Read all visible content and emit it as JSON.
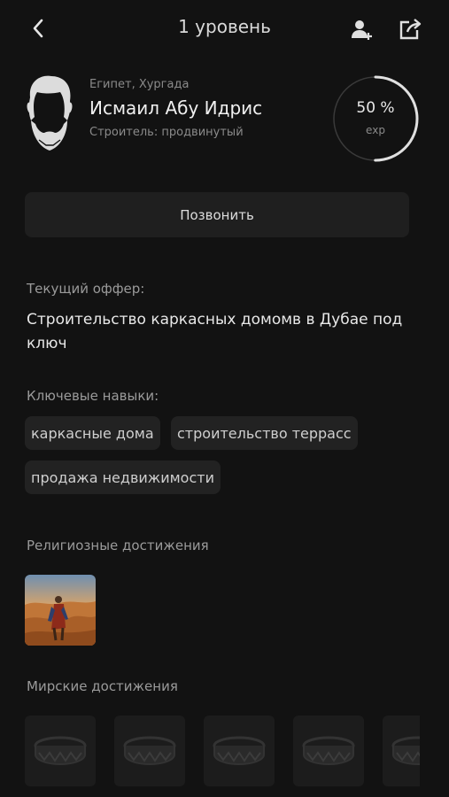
{
  "header": {
    "title": "1 уровень",
    "back_icon": "chevron-left-icon",
    "add_friend_icon": "add-person-icon",
    "share_icon": "share-icon"
  },
  "profile": {
    "location": "Египет, Хургада",
    "name": "Исмаил Абу Идрис",
    "role": "Строитель: продвинутый",
    "exp_percent_label": "50 %",
    "exp_label": "exp",
    "exp_fraction": 0.5
  },
  "call_button": "Позвонить",
  "current_offer": {
    "label": "Текущий оффер:",
    "text": "Строительство каркасных домомв в Дубае под ключ"
  },
  "skills": {
    "label": "Ключевые навыки:",
    "items": [
      "каркасные дома",
      "строительство террасс",
      "продажа недвижимости"
    ]
  },
  "religious": {
    "label": "Религиозные достижения"
  },
  "worldly": {
    "label": "Мирские достижения",
    "badge_count": 5
  },
  "colors": {
    "background": "#121212",
    "ring_active": "#e0e0e0",
    "ring_track": "#3a3a3a"
  }
}
